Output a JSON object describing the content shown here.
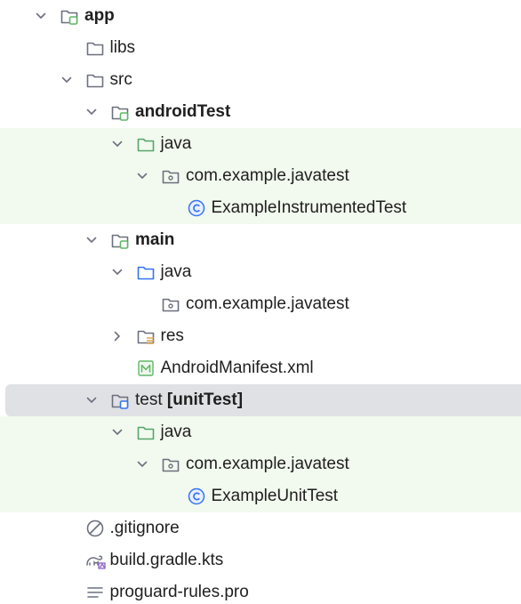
{
  "tree": [
    {
      "id": "app",
      "label": "app",
      "icon": "module-folder-icon",
      "depth": 0,
      "expanded": true,
      "bold": true,
      "bg": "none"
    },
    {
      "id": "libs",
      "label": "libs",
      "icon": "folder-icon",
      "depth": 1,
      "expanded": null,
      "bold": false,
      "bg": "none"
    },
    {
      "id": "src",
      "label": "src",
      "icon": "folder-icon",
      "depth": 1,
      "expanded": true,
      "bold": false,
      "bg": "none"
    },
    {
      "id": "androidTest",
      "label": "androidTest",
      "icon": "module-folder-icon",
      "depth": 2,
      "expanded": true,
      "bold": true,
      "bg": "none"
    },
    {
      "id": "androidTest-java",
      "label": "java",
      "icon": "test-source-folder-icon",
      "depth": 3,
      "expanded": true,
      "bold": false,
      "bg": "test"
    },
    {
      "id": "androidTest-pkg",
      "label": "com.example.javatest",
      "icon": "package-icon",
      "depth": 4,
      "expanded": true,
      "bold": false,
      "bg": "test"
    },
    {
      "id": "ExampleInstrumentedTest",
      "label": "ExampleInstrumentedTest",
      "icon": "class-icon",
      "depth": 5,
      "expanded": null,
      "bold": false,
      "bg": "test"
    },
    {
      "id": "main",
      "label": "main",
      "icon": "module-folder-icon",
      "depth": 2,
      "expanded": true,
      "bold": true,
      "bg": "none"
    },
    {
      "id": "main-java",
      "label": "java",
      "icon": "source-folder-icon",
      "depth": 3,
      "expanded": true,
      "bold": false,
      "bg": "none"
    },
    {
      "id": "main-pkg",
      "label": "com.example.javatest",
      "icon": "package-icon",
      "depth": 4,
      "expanded": null,
      "bold": false,
      "bg": "none"
    },
    {
      "id": "res",
      "label": "res",
      "icon": "resources-folder-icon",
      "depth": 3,
      "expanded": false,
      "bold": false,
      "bg": "none"
    },
    {
      "id": "AndroidManifest",
      "label": "AndroidManifest.xml",
      "icon": "manifest-icon",
      "depth": 3,
      "expanded": null,
      "bold": false,
      "bg": "none"
    },
    {
      "id": "test",
      "label": "test",
      "suffix": " [unitTest]",
      "icon": "module-folder-blue-icon",
      "depth": 2,
      "expanded": true,
      "bold": false,
      "bg": "none",
      "selected": true
    },
    {
      "id": "test-java",
      "label": "java",
      "icon": "test-source-folder-icon",
      "depth": 3,
      "expanded": true,
      "bold": false,
      "bg": "test"
    },
    {
      "id": "test-pkg",
      "label": "com.example.javatest",
      "icon": "package-icon",
      "depth": 4,
      "expanded": true,
      "bold": false,
      "bg": "test"
    },
    {
      "id": "ExampleUnitTest",
      "label": "ExampleUnitTest",
      "icon": "class-icon",
      "depth": 5,
      "expanded": null,
      "bold": false,
      "bg": "test"
    },
    {
      "id": "gitignore",
      "label": ".gitignore",
      "icon": "ignore-file-icon",
      "depth": 1,
      "expanded": null,
      "bold": false,
      "bg": "none"
    },
    {
      "id": "build-gradle",
      "label": "build.gradle.kts",
      "icon": "gradle-icon",
      "depth": 1,
      "expanded": null,
      "bold": false,
      "bg": "none"
    },
    {
      "id": "proguard",
      "label": "proguard-rules.pro",
      "icon": "text-file-icon",
      "depth": 1,
      "expanded": null,
      "bold": false,
      "bg": "none"
    }
  ],
  "colors": {
    "test_bg": "#f2f9ee",
    "selected_bg": "#dfe1e5",
    "folder_stroke": "#6c707e",
    "source_folder_stroke": "#3574f0",
    "test_folder_stroke": "#55a76a",
    "class_blue": "#3574f0",
    "manifest_green": "#5fb865",
    "gradle_purple": "#8c5fc9"
  }
}
